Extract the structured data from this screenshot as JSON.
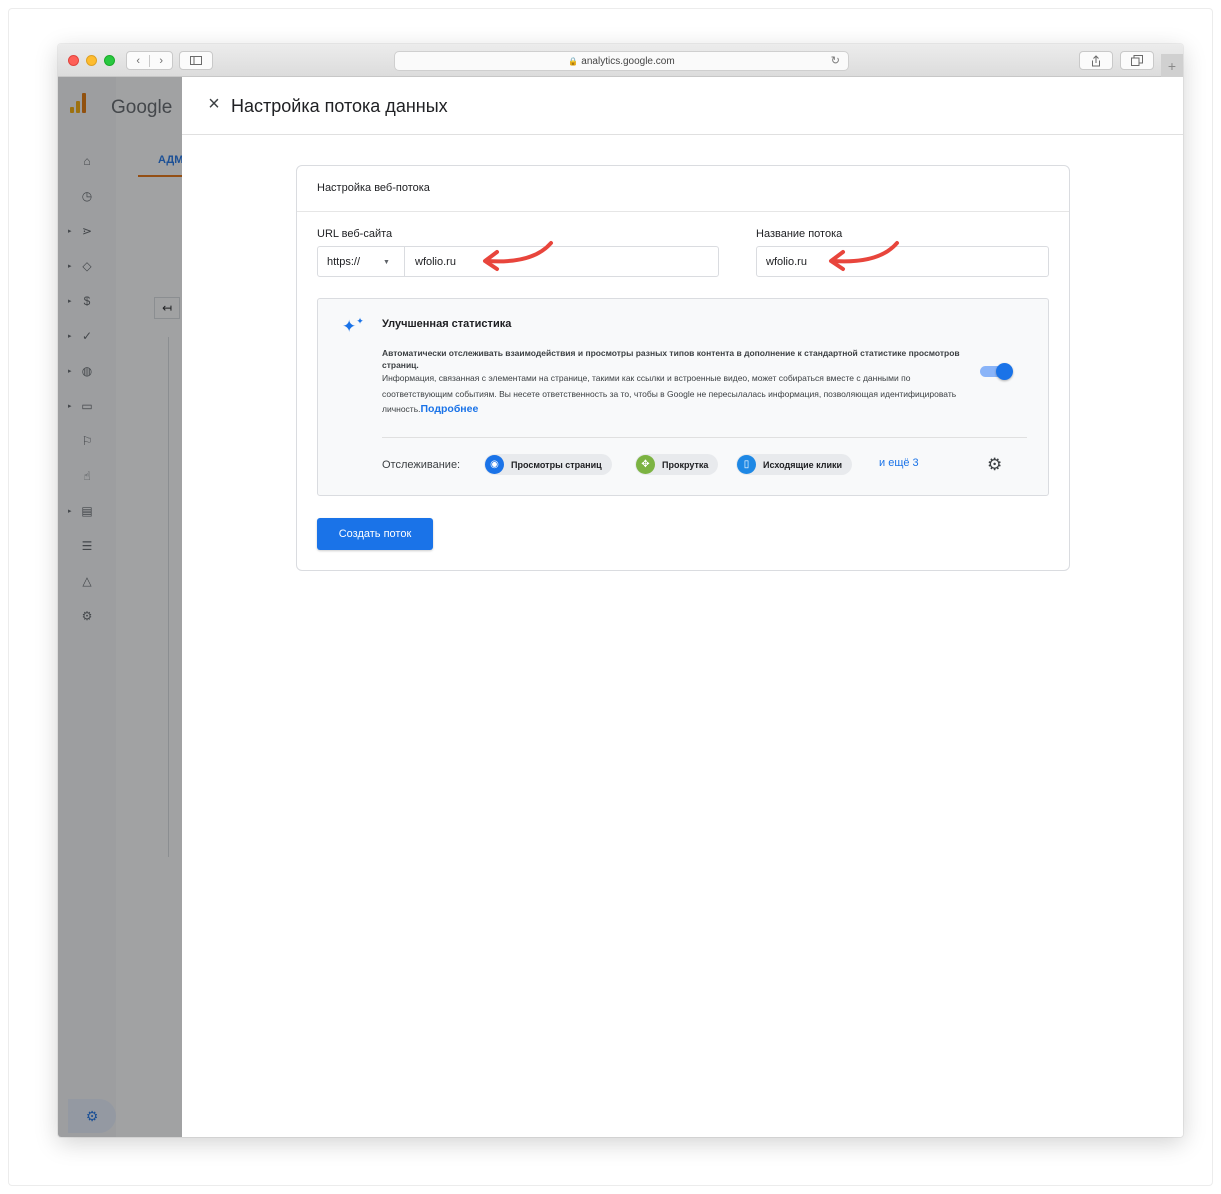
{
  "browser": {
    "url": "analytics.google.com",
    "nav_back": "‹",
    "nav_forward": "›"
  },
  "background": {
    "brand": "Google",
    "admin_tab": "АДМ"
  },
  "dialog": {
    "title": "Настройка потока данных",
    "card_title": "Настройка веб-потока",
    "url_label": "URL веб-сайта",
    "protocol": "https://",
    "url_value": "wfolio.ru",
    "stream_name_label": "Название потока",
    "stream_name_value": "wfolio.ru",
    "enhanced": {
      "title": "Улучшенная статистика",
      "desc_line1": "Автоматически отслеживать взаимодействия и просмотры разных типов контента в дополнение к стандартной статистике просмотров страниц.",
      "desc_line2": "Информация, связанная с элементами на странице, такими как ссылки и встроенные видео, может собираться вместе с данными по соответствующим событиям. Вы несете ответственность за то, чтобы в Google не пересылалась информация, позволяющая идентифицировать личность.",
      "learn_more": "Подробнее",
      "toggle_on": true,
      "tracking_label": "Отслеживание:",
      "chips": [
        {
          "label": "Просмотры страниц",
          "icon": "eye-icon",
          "color": "#1a73e8"
        },
        {
          "label": "Прокрутка",
          "icon": "scroll-icon",
          "color": "#7cb342"
        },
        {
          "label": "Исходящие клики",
          "icon": "mouse-icon",
          "color": "#1e88e5"
        }
      ],
      "more_link": "и ещё 3"
    },
    "create_button": "Создать поток"
  },
  "colors": {
    "accent": "#1a73e8",
    "annotation_arrow": "#e8453c"
  }
}
